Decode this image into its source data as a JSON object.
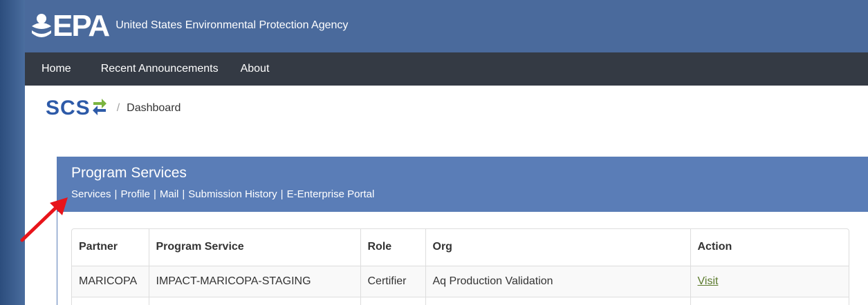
{
  "header": {
    "logo_text": "EPA",
    "agency_name": "United States Environmental Protection Agency"
  },
  "nav": {
    "items": [
      "Home",
      "Recent Announcements",
      "About"
    ]
  },
  "breadcrumb": {
    "app": "SCS",
    "separator": "/",
    "current": "Dashboard"
  },
  "panel": {
    "title": "Program Services",
    "links": [
      "Services",
      "Profile",
      "Mail",
      "Submission History",
      "E-Enterprise Portal"
    ],
    "link_separator": "|"
  },
  "table": {
    "columns": [
      "Partner",
      "Program Service",
      "Role",
      "Org",
      "Action"
    ],
    "rows": [
      {
        "partner": "MARICOPA",
        "program_service": "IMPACT-MARICOPA-STAGING",
        "role": "Certifier",
        "org": "Aq Production Validation",
        "action": "Visit"
      }
    ]
  },
  "colors": {
    "header_bg": "#4a6a9c",
    "navbar_bg": "#343a44",
    "panel_head_bg": "#5a7db7",
    "arrow": "#e8141a",
    "link_green": "#5b7a2c"
  },
  "icons": {
    "epa_logo": "epa-flower-icon",
    "scs_logo": "sync-arrows-icon",
    "annotation": "red-arrow-icon"
  }
}
